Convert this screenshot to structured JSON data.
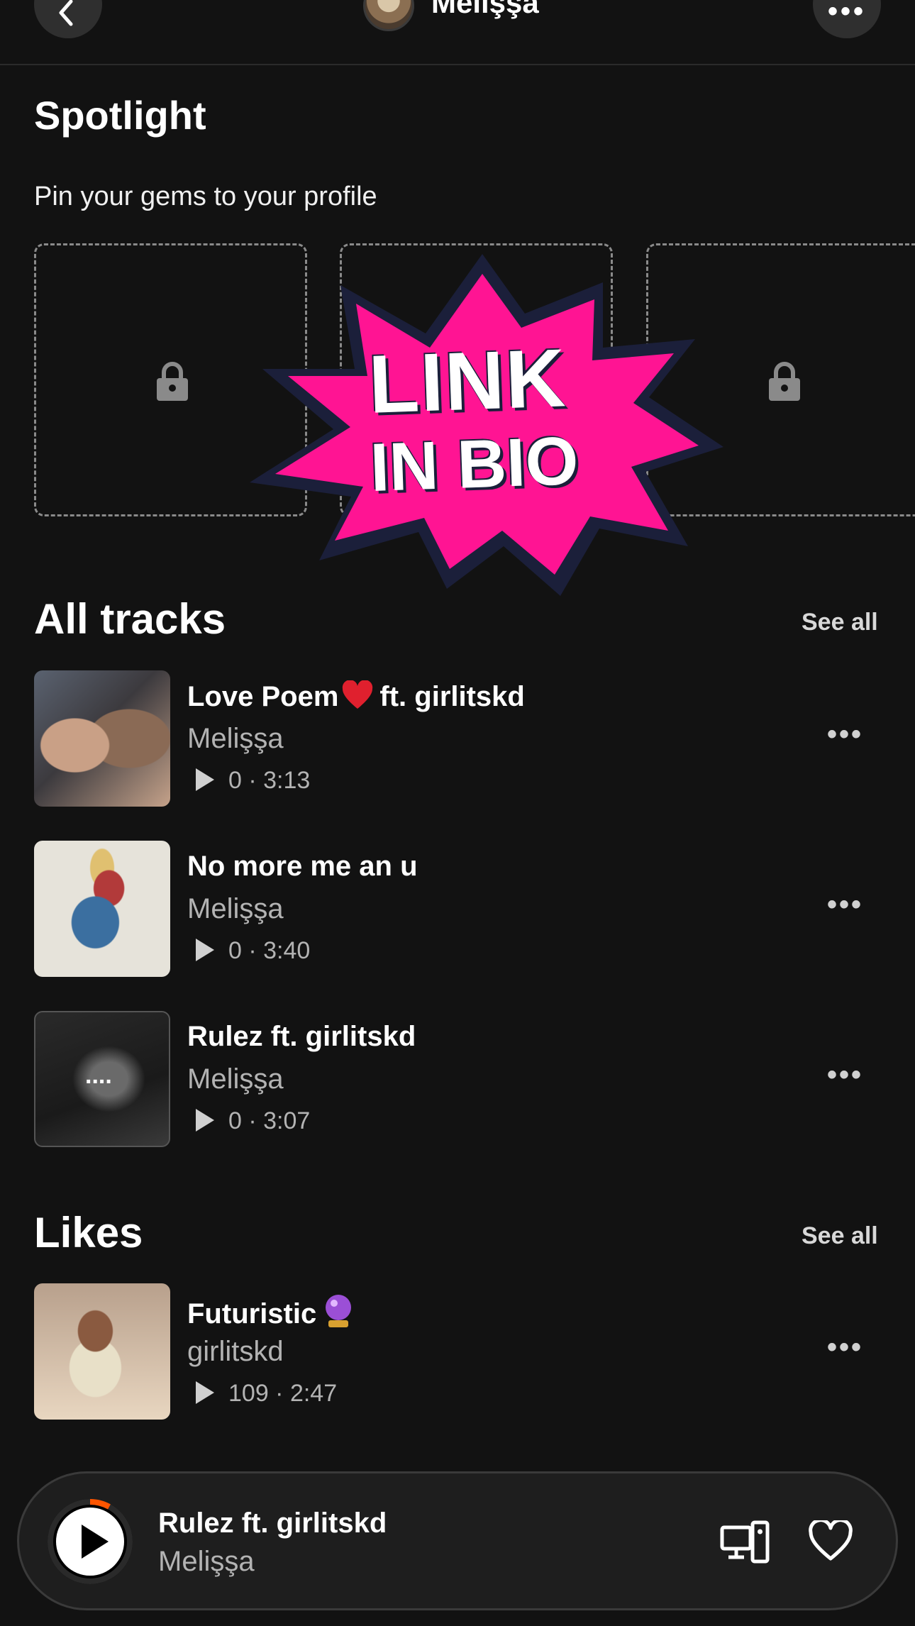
{
  "header": {
    "profile_name": "Melişşa",
    "back_icon": "chevron-left-icon",
    "more_icon": "more-horizontal-icon"
  },
  "spotlight": {
    "title": "Spotlight",
    "subtitle": "Pin your gems to your profile",
    "slots": [
      {
        "icon": "lock-icon"
      },
      {
        "icon": "lock-icon"
      },
      {
        "icon": "lock-icon"
      }
    ]
  },
  "sticker": {
    "line1": "LINK",
    "line2": "IN BIO",
    "color": "#ff1493"
  },
  "all_tracks": {
    "title": "All tracks",
    "see_all": "See all",
    "items": [
      {
        "title": "Love Poem",
        "title_suffix": "ft. girlitskd",
        "artist": "Melişşa",
        "plays": "0",
        "duration": "3:13"
      },
      {
        "title": "No more me an u",
        "artist": "Melişşa",
        "plays": "0",
        "duration": "3:40"
      },
      {
        "title": "Rulez ft. girlitskd",
        "artist": "Melişşa",
        "plays": "0",
        "duration": "3:07",
        "thumb_text": "...."
      }
    ]
  },
  "likes": {
    "title": "Likes",
    "see_all": "See all",
    "items": [
      {
        "title": "Futuristic",
        "artist": "girlitskd",
        "plays": "109",
        "duration": "2:47"
      }
    ]
  },
  "mini_player": {
    "title": "Rulez ft. girlitskd",
    "artist": "Melişşa",
    "progress": 0.08,
    "accent": "#ff5500"
  }
}
